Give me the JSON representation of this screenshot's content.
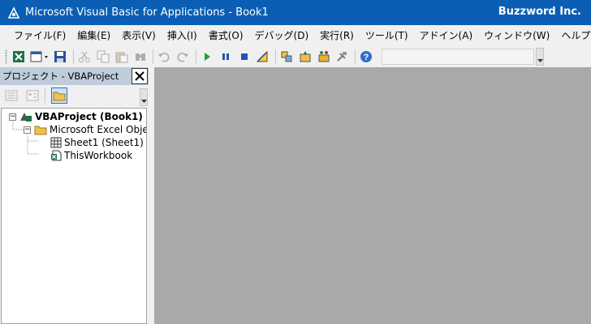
{
  "window": {
    "title": "Microsoft Visual Basic for Applications - Book1",
    "brand": "Buzzword Inc."
  },
  "menu": [
    {
      "label": "ファイル(F)"
    },
    {
      "label": "編集(E)"
    },
    {
      "label": "表示(V)"
    },
    {
      "label": "挿入(I)"
    },
    {
      "label": "書式(O)"
    },
    {
      "label": "デバッグ(D)"
    },
    {
      "label": "実行(R)"
    },
    {
      "label": "ツール(T)"
    },
    {
      "label": "アドイン(A)"
    },
    {
      "label": "ウィンドウ(W)"
    },
    {
      "label": "ヘルプ(H)"
    }
  ],
  "toolbar": {
    "icons": [
      "view-excel-icon",
      "insert-userform-icon",
      "save-icon",
      "cut-icon",
      "copy-icon",
      "paste-icon",
      "find-icon",
      "undo-icon",
      "redo-icon",
      "run-icon",
      "break-icon",
      "reset-icon",
      "design-mode-icon",
      "project-explorer-icon",
      "properties-icon",
      "object-browser-icon",
      "toolbox-icon",
      "help-icon"
    ]
  },
  "project_pane": {
    "title": "プロジェクト - VBAProject",
    "tree": [
      {
        "label": "VBAProject (Book1)",
        "toggle": "−"
      },
      {
        "label": "Microsoft Excel Objects",
        "toggle": "−"
      },
      {
        "label": "Sheet1 (Sheet1)"
      },
      {
        "label": "ThisWorkbook"
      }
    ]
  },
  "colors": {
    "titlebar": "#0a5fb4",
    "pane_header": "#bfcddb",
    "workspace": "#a9a9a9"
  }
}
